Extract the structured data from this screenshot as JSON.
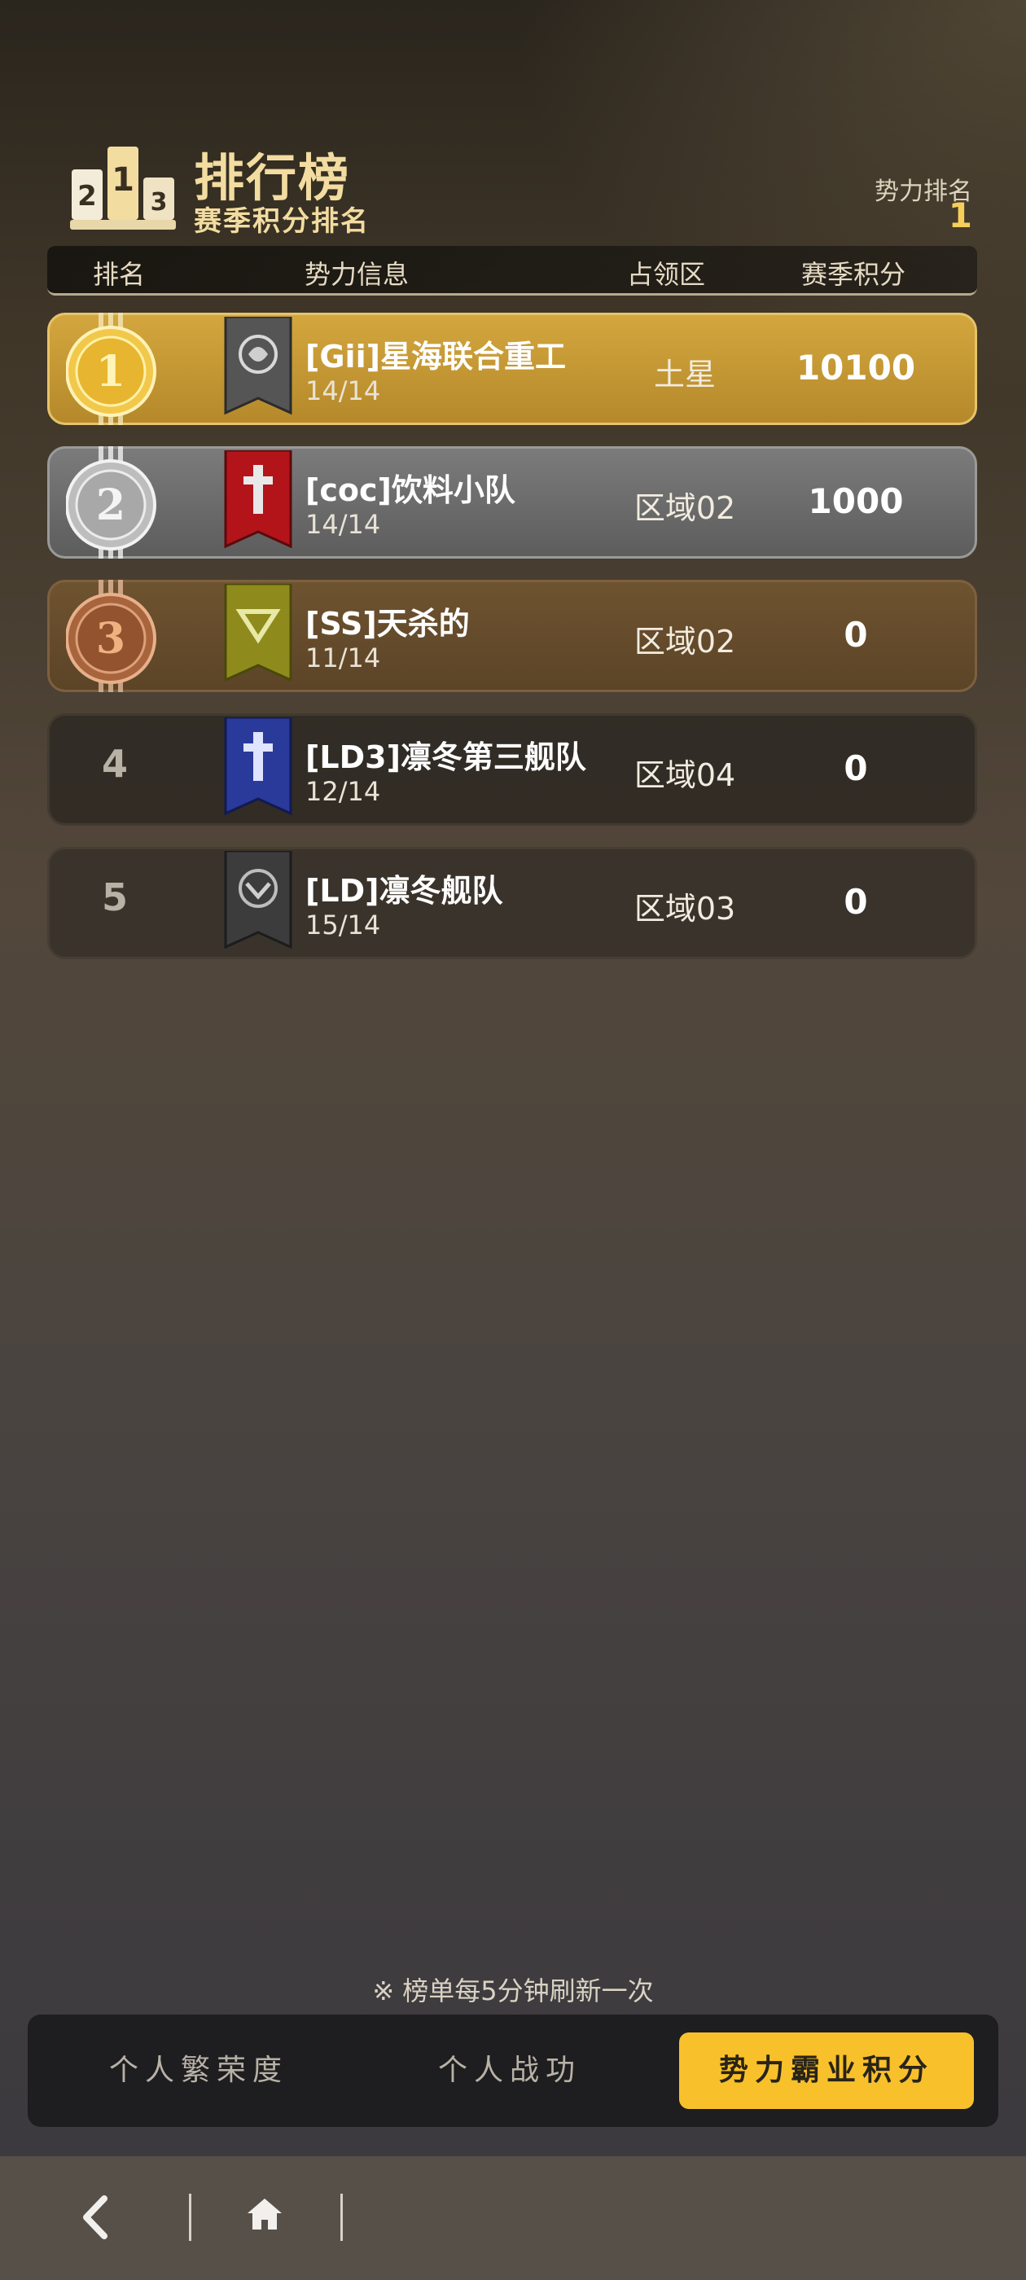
{
  "header": {
    "title": "排行榜",
    "subtitle": "赛季积分排名",
    "my_rank_label": "势力排名",
    "my_rank_value": "1",
    "podium_digits": [
      "2",
      "1",
      "3"
    ]
  },
  "columns": {
    "rank": "排名",
    "faction_info": "势力信息",
    "region": "占领区",
    "season_points": "赛季积分"
  },
  "rows": [
    {
      "rank": "1",
      "name": "[Gii]星海联合重工",
      "members": "14/14",
      "region": "土星",
      "score": "10100",
      "banner_color": "#555555"
    },
    {
      "rank": "2",
      "name": "[coc]饮料小队",
      "members": "14/14",
      "region": "区域02",
      "score": "1000",
      "banner_color": "#b3141a"
    },
    {
      "rank": "3",
      "name": "[SS]天杀的",
      "members": "11/14",
      "region": "区域02",
      "score": "0",
      "banner_color": "#8e8b1c"
    },
    {
      "rank": "4",
      "name": "[LD3]凛冬第三舰队",
      "members": "12/14",
      "region": "区域04",
      "score": "0",
      "banner_color": "#2a3a9a"
    },
    {
      "rank": "5",
      "name": "[LD]凛冬舰队",
      "members": "15/14",
      "region": "区域03",
      "score": "0",
      "banner_color": "#3c3c3c"
    }
  ],
  "footer": {
    "refresh_note": "※ 榜单每5分钟刷新一次",
    "tabs": [
      "个人繁荣度",
      "个人战功",
      "势力霸业积分"
    ],
    "active_tab": "势力霸业积分"
  },
  "colors": {
    "accent": "#f8c12b",
    "gold": "#d3a63e",
    "silver": "#7b7b7b",
    "bronze": "#6e5330"
  },
  "icons": {
    "back": "back-arrow-icon",
    "home": "home-icon"
  }
}
